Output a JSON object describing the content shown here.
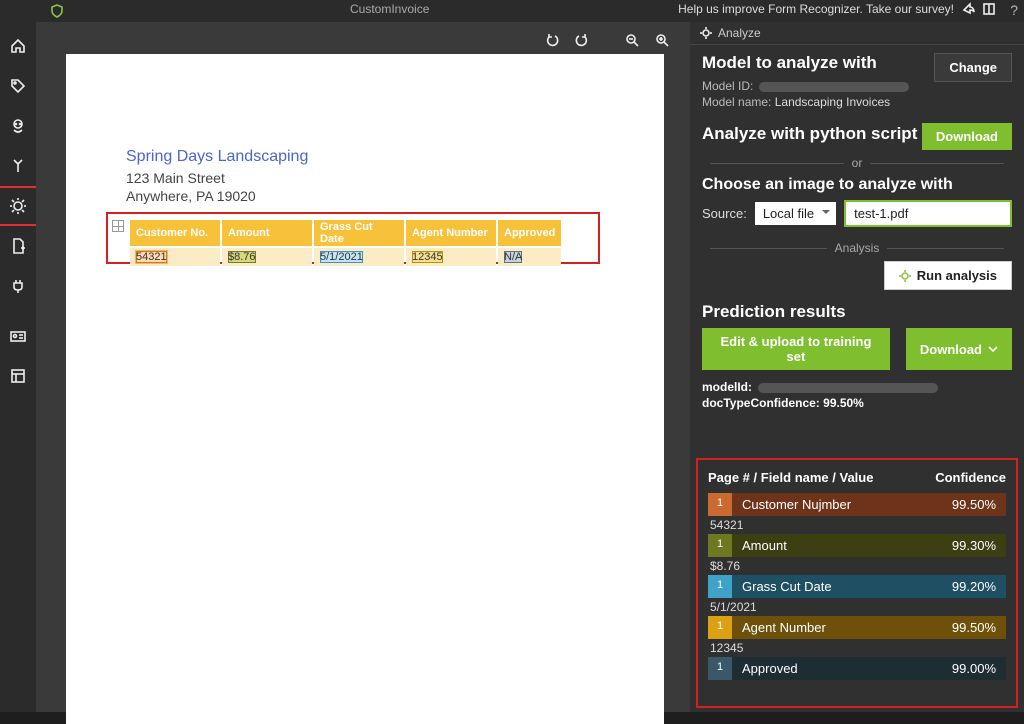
{
  "topbar": {
    "title": "CustomInvoice",
    "survey_text": "Help us improve Form Recognizer. Take our survey!"
  },
  "document": {
    "company": "Spring Days Landscaping",
    "address1": "123 Main Street",
    "address2": "Anywhere, PA 19020",
    "table": {
      "headers": [
        "Customer No.",
        "Amount",
        "Grass Cut Date",
        "Agent Number",
        "Approved"
      ],
      "row": [
        "54321",
        "$8.76",
        "5/1/2021",
        "12345",
        "N/A"
      ]
    }
  },
  "panel": {
    "analyze_tab": "Analyze",
    "model_to_analyze": "Model to analyze with",
    "model_id_label": "Model ID:",
    "model_name_label": "Model name:",
    "model_name_value": "Landscaping Invoices",
    "change_btn": "Change",
    "python_script": "Analyze with python script",
    "download_btn": "Download",
    "or_label": "or",
    "choose_img": "Choose an image to analyze with",
    "source_label": "Source:",
    "source_value": "Local file",
    "filename": "test-1.pdf",
    "analysis_label": "Analysis",
    "run_analysis": "Run analysis",
    "prediction_results": "Prediction results",
    "edit_upload_btn": "Edit & upload to training set",
    "download2_btn": "Download",
    "modelId_label": "modelId:",
    "doctype_label": "docTypeConfidence:",
    "doctype_value": "99.50%"
  },
  "predictions": {
    "header_left": "Page # / Field name / Value",
    "header_right": "Confidence",
    "rows": [
      {
        "page": "1",
        "field": "Customer Nujmber",
        "value": "54321",
        "conf": "99.50%",
        "color": "orange"
      },
      {
        "page": "1",
        "field": "Amount",
        "value": "$8.76",
        "conf": "99.30%",
        "color": "olive"
      },
      {
        "page": "1",
        "field": "Grass Cut Date",
        "value": "5/1/2021",
        "conf": "99.20%",
        "color": "cyan"
      },
      {
        "page": "1",
        "field": "Agent Number",
        "value": "12345",
        "conf": "99.50%",
        "color": "gold"
      },
      {
        "page": "1",
        "field": "Approved",
        "value": "",
        "conf": "99.00%",
        "color": "steel"
      }
    ]
  }
}
